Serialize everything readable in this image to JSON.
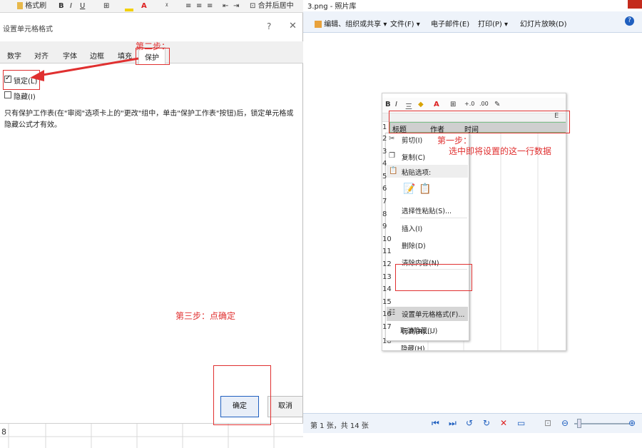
{
  "excel_ribbon": {
    "format_painter": "格式刷",
    "bold": "B",
    "italic": "I",
    "underline": "U",
    "merge": "合并后居中"
  },
  "dialog": {
    "title": "设置单元格格式",
    "help": "?",
    "close": "✕",
    "tabs": [
      "数字",
      "对齐",
      "字体",
      "边框",
      "填充",
      "保护"
    ],
    "locked_label": "锁定(L)",
    "locked_checked": true,
    "hidden_label": "隐藏(I)",
    "hidden_checked": false,
    "description": "只有保护工作表(在\"审阅\"选项卡上的\"更改\"组中，单击\"保护工作表\"按钮)后，锁定单元格或隐藏公式才有效。",
    "ok_label": "确定",
    "cancel_label": "取消"
  },
  "excel_bottom": {
    "row_number": "8"
  },
  "photo_viewer": {
    "title": "3.png - 照片库",
    "menu": {
      "edit": "编辑、组织或共享",
      "file": "文件(F)",
      "email": "电子邮件(E)",
      "print": "打印(P)",
      "slideshow": "幻灯片放映(D)"
    },
    "help": "?",
    "status": "第 1 张，共 14 张",
    "embedded": {
      "toolbar": {
        "bold": "B",
        "italic": "I",
        "align": "三",
        "font_color": "A",
        "border": "⊞",
        "inc_dec": "+.0",
        "dec_dec": ".00"
      },
      "column_e": "E",
      "headers": [
        "标题",
        "作者",
        "时间"
      ],
      "row_numbers": [
        "1",
        "2",
        "3",
        "4",
        "5",
        "6",
        "7",
        "8",
        "9",
        "10",
        "11",
        "12",
        "13",
        "14",
        "15",
        "16",
        "17",
        "18"
      ],
      "context_menu": {
        "cut": "剪切(I)",
        "copy": "复制(C)",
        "paste_options": "粘贴选项:",
        "paste_special": "选择性粘贴(S)...",
        "insert": "插入(I)",
        "delete": "删除(D)",
        "clear": "清除内容(N)",
        "format_cells": "设置单元格格式(F)...",
        "row_height": "行高(R)...",
        "hide": "隐藏(H)",
        "unhide": "取消隐藏(U)"
      }
    }
  },
  "annotations": {
    "step1_a": "第一步：",
    "step1_b": "选中即将设置的这一行数据",
    "step2": "第二步：",
    "step3": "第三步：点确定"
  },
  "colors": {
    "annotation": "#e03030",
    "accent": "#1f5fbf",
    "selection_border": "#7cc08a"
  }
}
